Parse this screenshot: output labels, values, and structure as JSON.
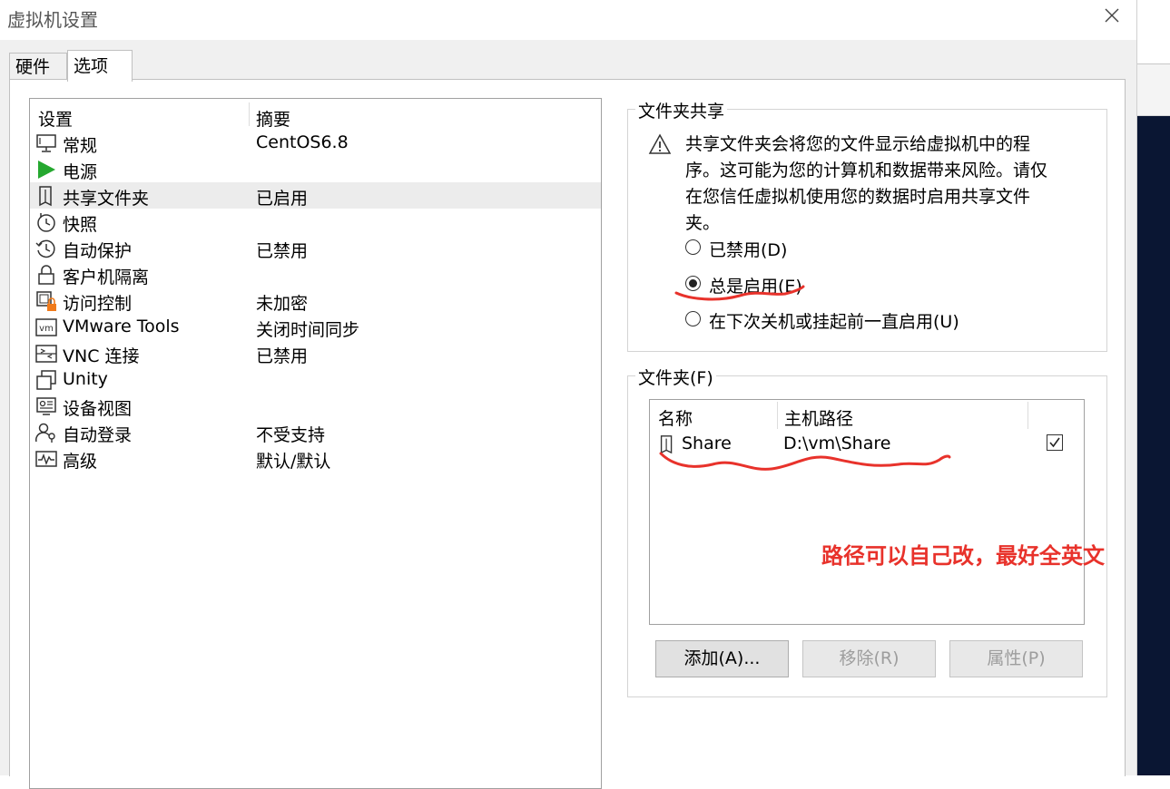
{
  "window": {
    "title": "虚拟机设置"
  },
  "tabs": [
    {
      "label": "硬件",
      "active": false
    },
    {
      "label": "选项",
      "active": true
    }
  ],
  "settings_list": {
    "headers": {
      "setting": "设置",
      "summary": "摘要"
    },
    "selected_index": 2,
    "items": [
      {
        "icon": "monitor-icon",
        "name": "常规",
        "summary": "CentOS6.8"
      },
      {
        "icon": "play-icon",
        "name": "电源",
        "summary": ""
      },
      {
        "icon": "shared-folder-icon",
        "name": "共享文件夹",
        "summary": "已启用"
      },
      {
        "icon": "snapshot-clock-icon",
        "name": "快照",
        "summary": ""
      },
      {
        "icon": "autoprotect-clock-icon",
        "name": "自动保护",
        "summary": "已禁用"
      },
      {
        "icon": "lock-icon",
        "name": "客户机隔离",
        "summary": ""
      },
      {
        "icon": "access-control-icon",
        "name": "访问控制",
        "summary": "未加密"
      },
      {
        "icon": "vm-tools-icon",
        "name": "VMware Tools",
        "summary": "关闭时间同步"
      },
      {
        "icon": "vnc-icon",
        "name": "VNC 连接",
        "summary": "已禁用"
      },
      {
        "icon": "unity-icon",
        "name": "Unity",
        "summary": ""
      },
      {
        "icon": "device-view-icon",
        "name": "设备视图",
        "summary": ""
      },
      {
        "icon": "autologin-icon",
        "name": "自动登录",
        "summary": "不受支持"
      },
      {
        "icon": "advanced-pulse-icon",
        "name": "高级",
        "summary": "默认/默认"
      }
    ]
  },
  "folder_sharing": {
    "title": "文件夹共享",
    "warning": "共享文件夹会将您的文件显示给虚拟机中的程序。这可能为您的计算机和数据带来风险。请仅在您信任虚拟机使用您的数据时启用共享文件夹。",
    "options": [
      {
        "label": "已禁用(D)",
        "selected": false
      },
      {
        "label": "总是启用(E)",
        "selected": true
      },
      {
        "label": "在下次关机或挂起前一直启用(U)",
        "selected": false
      }
    ]
  },
  "folders": {
    "title": "文件夹(F)",
    "headers": {
      "name": "名称",
      "host_path": "主机路径"
    },
    "rows": [
      {
        "name": "Share",
        "host_path": "D:\\vm\\Share",
        "enabled": true
      }
    ],
    "buttons": {
      "add": "添加(A)...",
      "remove": "移除(R)",
      "properties": "属性(P)"
    }
  },
  "annotation": {
    "text": "路径可以自己改，最好全英文",
    "color": "#e8322b"
  }
}
